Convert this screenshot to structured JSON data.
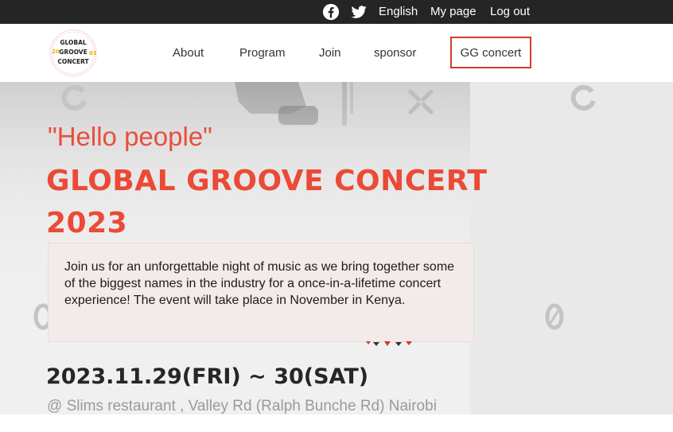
{
  "topbar": {
    "social": [
      {
        "icon": "facebook-icon"
      },
      {
        "icon": "twitter-icon"
      }
    ],
    "links": {
      "english": "English",
      "mypage": "My page",
      "logout": "Log out"
    }
  },
  "header": {
    "logo": {
      "line1": "GLOBAL",
      "line2": "GROOVE",
      "line3": "CONCERT",
      "year_left": "20",
      "year_right": "01"
    },
    "nav": {
      "about": "About",
      "program": "Program",
      "join": "Join",
      "sponsor": "sponsor",
      "gg_concert": "GG concert"
    }
  },
  "hero": {
    "hello": "\"Hello people\"",
    "title_line1": "GLOBAL GROOVE CONCERT",
    "title_line2": "2023",
    "description": "Join us for an unforgettable night of music as we bring together some of the biggest names in the industry for a once-in-a-lifetime concert experience! The event will take place in November in Kenya.",
    "date": "2023.11.29(FRI) ~ 30(SAT)",
    "venue": "@ Slims restaurant , Valley Rd (Ralph Bunche Rd) Nairobi"
  },
  "colors": {
    "accent": "#ea4a37",
    "topbar": "#252525",
    "box_border": "#d33b2c"
  }
}
